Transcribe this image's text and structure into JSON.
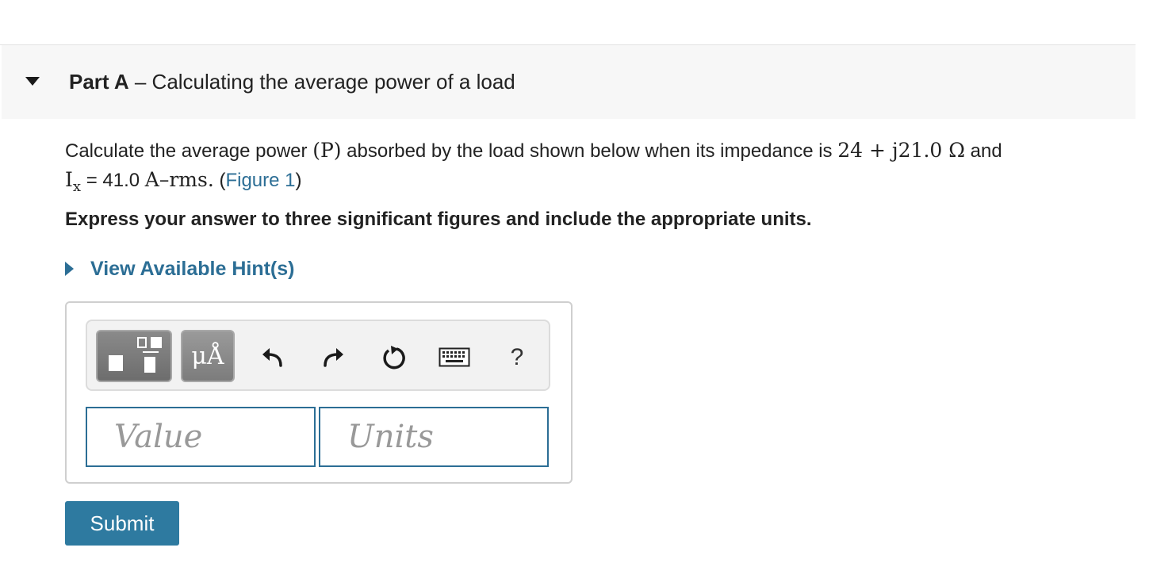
{
  "part": {
    "label": "Part A",
    "separator": " – ",
    "title": "Calculating the average power of a load"
  },
  "problem": {
    "text_1": "Calculate the average power ",
    "symbol_p": "(P)",
    "text_2": " absorbed by the load shown below when its impedance is ",
    "impedance": "24 + j21.0 Ω",
    "text_3": " and",
    "current_symbol": "I",
    "current_subscript": "x",
    "current_eq": " = 41.0 ",
    "current_units": "A–rms.",
    "paren_open": " (",
    "figure_link": "Figure 1",
    "paren_close": ")"
  },
  "instructions": "Express your answer to three significant figures and include the appropriate units.",
  "hints": {
    "label": "View Available Hint(s)"
  },
  "toolbar": {
    "units_label": "μÅ",
    "help_label": "?",
    "icons": [
      "templates-icon",
      "units-icon",
      "undo-icon",
      "redo-icon",
      "reset-icon",
      "keyboard-icon",
      "help-icon"
    ]
  },
  "inputs": {
    "value_placeholder": "Value",
    "units_placeholder": "Units"
  },
  "submit_label": "Submit",
  "colors": {
    "link": "#2c6e95",
    "button": "#2e7aa0",
    "header_bg": "#f7f7f7"
  }
}
